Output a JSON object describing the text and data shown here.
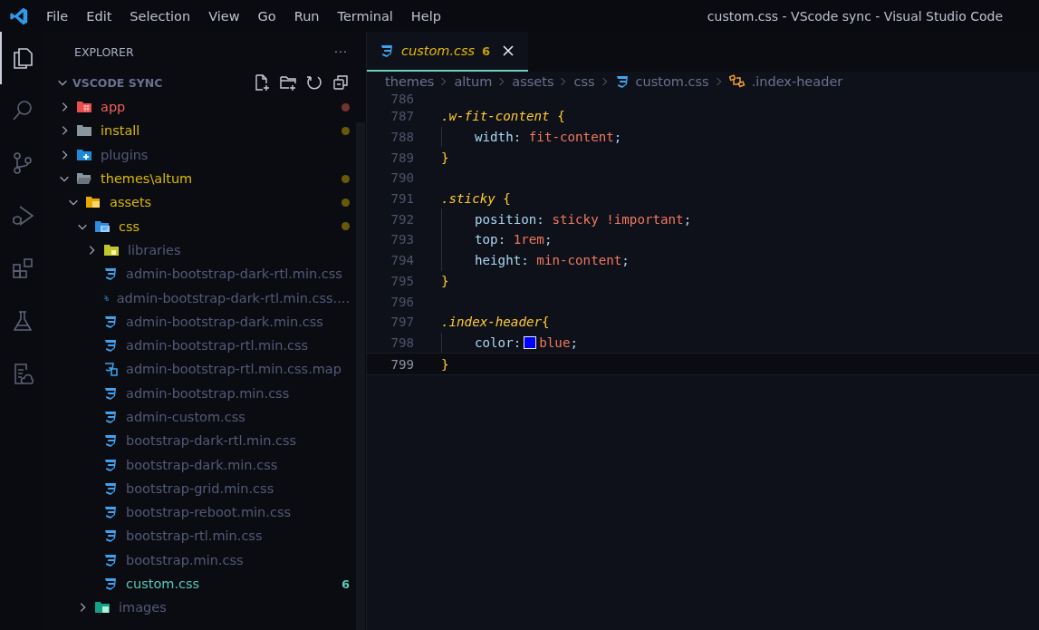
{
  "window": {
    "title": "custom.css - VScode sync - Visual Studio Code"
  },
  "menu": [
    "File",
    "Edit",
    "Selection",
    "View",
    "Go",
    "Run",
    "Terminal",
    "Help"
  ],
  "activity_bar": [
    {
      "kind": "explorer",
      "selected": true
    },
    {
      "kind": "search",
      "selected": false
    },
    {
      "kind": "source-control",
      "selected": false
    },
    {
      "kind": "run",
      "selected": false
    },
    {
      "kind": "extensions",
      "selected": false
    },
    {
      "kind": "testing",
      "selected": false
    },
    {
      "kind": "remote",
      "selected": false
    }
  ],
  "sidebar": {
    "title": "EXPLORER",
    "more": "···",
    "workspace": "VSCODE SYNC",
    "tree": [
      {
        "label": "app",
        "kind": "app",
        "expanded": false,
        "color": "#f2605a",
        "dot": true
      },
      {
        "label": "install",
        "kind": "folder",
        "expanded": false,
        "color": "#d8b800",
        "dot": true
      },
      {
        "label": "plugins",
        "kind": "plugin",
        "expanded": false,
        "color": "#535a78",
        "dot": false
      },
      {
        "label": "themes\\altum",
        "kind": "folder",
        "expanded": true,
        "color": "#d8b800",
        "dot": true,
        "children": [
          {
            "label": "assets",
            "kind": "assets",
            "expanded": true,
            "color": "#d8b800",
            "dot": true,
            "children": [
              {
                "label": "css",
                "kind": "css-folder",
                "expanded": true,
                "color": "#d8b800",
                "dot": true,
                "children": [
                  {
                    "label": "libraries",
                    "kind": "lib",
                    "expanded": false,
                    "color": "#535a78",
                    "dot": false
                  },
                  {
                    "label": "admin-bootstrap-dark-rtl.min.css",
                    "kind": "css",
                    "color": "#535a78",
                    "dot": false
                  },
                  {
                    "label": "admin-bootstrap-dark-rtl.min.css....",
                    "kind": "map",
                    "color": "#535a78",
                    "dot": false
                  },
                  {
                    "label": "admin-bootstrap-dark.min.css",
                    "kind": "css",
                    "color": "#535a78",
                    "dot": false
                  },
                  {
                    "label": "admin-bootstrap-rtl.min.css",
                    "kind": "css",
                    "color": "#535a78",
                    "dot": false
                  },
                  {
                    "label": "admin-bootstrap-rtl.min.css.map",
                    "kind": "map",
                    "color": "#535a78",
                    "dot": false
                  },
                  {
                    "label": "admin-bootstrap.min.css",
                    "kind": "css",
                    "color": "#535a78",
                    "dot": false
                  },
                  {
                    "label": "admin-custom.css",
                    "kind": "css",
                    "color": "#535a78",
                    "dot": false
                  },
                  {
                    "label": "bootstrap-dark-rtl.min.css",
                    "kind": "css",
                    "color": "#535a78",
                    "dot": false
                  },
                  {
                    "label": "bootstrap-dark.min.css",
                    "kind": "css",
                    "color": "#535a78",
                    "dot": false
                  },
                  {
                    "label": "bootstrap-grid.min.css",
                    "kind": "css",
                    "color": "#535a78",
                    "dot": false
                  },
                  {
                    "label": "bootstrap-reboot.min.css",
                    "kind": "css",
                    "color": "#535a78",
                    "dot": false
                  },
                  {
                    "label": "bootstrap-rtl.min.css",
                    "kind": "css",
                    "color": "#535a78",
                    "dot": false
                  },
                  {
                    "label": "bootstrap.min.css",
                    "kind": "css",
                    "color": "#535a78",
                    "dot": false
                  },
                  {
                    "label": "custom.css",
                    "kind": "css",
                    "color": "#56c8b4",
                    "dot": false,
                    "badge": "6"
                  }
                ]
              },
              {
                "label": "images",
                "kind": "images",
                "expanded": false,
                "color": "#535a78",
                "dot": false
              }
            ]
          }
        ]
      }
    ]
  },
  "tabs": [
    {
      "label": "custom.css",
      "badge": "6",
      "selected": true
    }
  ],
  "breadcrumbs": [
    {
      "label": "themes",
      "kind": "text"
    },
    {
      "label": "altum",
      "kind": "text"
    },
    {
      "label": "assets",
      "kind": "text"
    },
    {
      "label": "css",
      "kind": "text"
    },
    {
      "label": "custom.css",
      "kind": "css"
    },
    {
      "label": ".index-header",
      "kind": "selector"
    }
  ],
  "editor": {
    "lines": [
      {
        "number": "786"
      },
      {
        "number": "787",
        "tokens": [
          {
            "kind": "selector",
            "text": ".w-fit-content"
          },
          {
            "kind": "brace",
            "text": " {"
          }
        ]
      },
      {
        "number": "788",
        "tokens": [
          {
            "kind": "property",
            "text": "width"
          },
          {
            "kind": "punct",
            "text": ": "
          },
          {
            "kind": "value",
            "text": "fit-content"
          },
          {
            "kind": "punct",
            "text": ";"
          }
        ]
      },
      {
        "number": "789",
        "tokens": [
          {
            "kind": "brace",
            "text": "}"
          }
        ]
      },
      {
        "number": "790"
      },
      {
        "number": "791",
        "tokens": [
          {
            "kind": "selector",
            "text": ".sticky"
          },
          {
            "kind": "brace",
            "text": " {"
          }
        ]
      },
      {
        "number": "792",
        "tokens": [
          {
            "kind": "property",
            "text": "position"
          },
          {
            "kind": "punct",
            "text": ": "
          },
          {
            "kind": "value",
            "text": "sticky !important"
          },
          {
            "kind": "punct",
            "text": ";"
          }
        ]
      },
      {
        "number": "793",
        "tokens": [
          {
            "kind": "property",
            "text": "top"
          },
          {
            "kind": "punct",
            "text": ": "
          },
          {
            "kind": "value",
            "text": "1rem"
          },
          {
            "kind": "punct",
            "text": ";"
          }
        ]
      },
      {
        "number": "794",
        "tokens": [
          {
            "kind": "property",
            "text": "height"
          },
          {
            "kind": "punct",
            "text": ": "
          },
          {
            "kind": "value",
            "text": "min-content"
          },
          {
            "kind": "punct",
            "text": ";"
          }
        ]
      },
      {
        "number": "795",
        "tokens": [
          {
            "kind": "brace",
            "text": "}"
          }
        ]
      },
      {
        "number": "796"
      },
      {
        "number": "797",
        "tokens": [
          {
            "kind": "selector",
            "text": ".index-header"
          },
          {
            "kind": "brace",
            "text": "{"
          }
        ]
      },
      {
        "number": "798",
        "tokens": [
          {
            "kind": "property",
            "text": "color"
          },
          {
            "kind": "punct",
            "text": ":"
          },
          {
            "kind": "swatch",
            "color": "#0000ff"
          },
          {
            "kind": "value",
            "text": "blue"
          },
          {
            "kind": "punct",
            "text": ";"
          }
        ]
      },
      {
        "number": "799",
        "current": true,
        "tokens": [
          {
            "kind": "brace",
            "text": "}"
          }
        ]
      }
    ]
  }
}
